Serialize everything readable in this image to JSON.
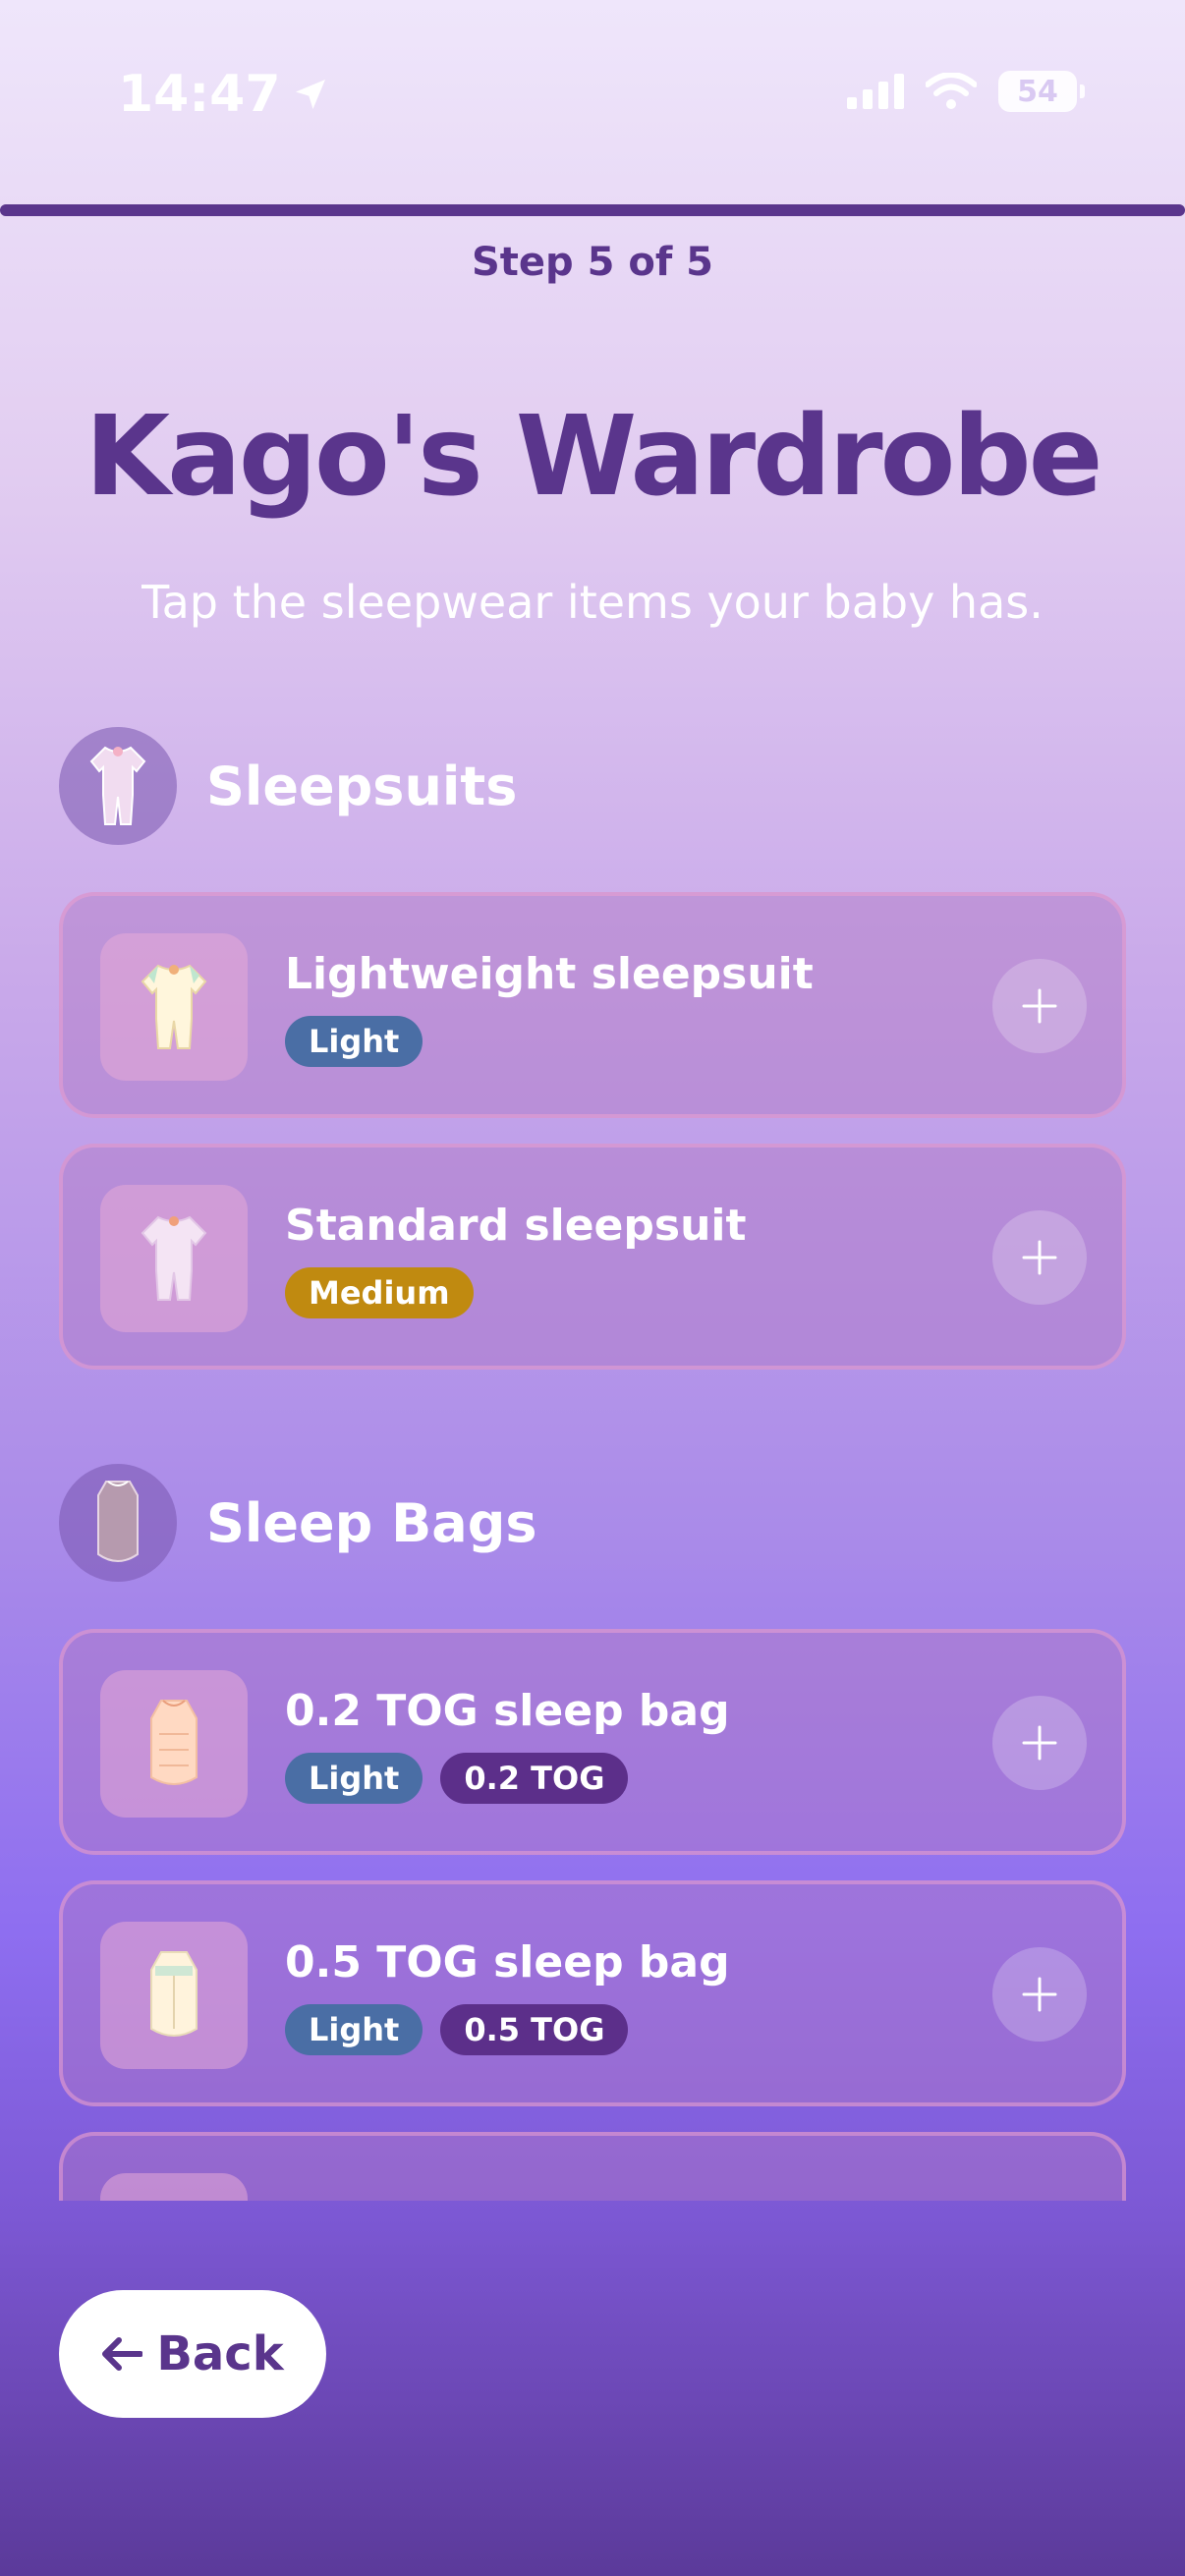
{
  "status_bar": {
    "time": "14:47",
    "battery": "54"
  },
  "progress": {
    "fraction": 1.0,
    "label": "Step 5 of 5"
  },
  "header": {
    "title": "Kago's Wardrobe",
    "subtitle": "Tap the sleepwear items your baby has."
  },
  "sections": [
    {
      "title": "Sleepsuits",
      "icon": "sleepsuit-icon",
      "items": [
        {
          "name": "Lightweight sleepsuit",
          "tags": [
            "Light"
          ]
        },
        {
          "name": "Standard sleepsuit",
          "tags": [
            "Medium"
          ]
        }
      ]
    },
    {
      "title": "Sleep Bags",
      "icon": "sleep-bag-icon",
      "items": [
        {
          "name": "0.2 TOG sleep bag",
          "tags": [
            "Light",
            "0.2 TOG"
          ]
        },
        {
          "name": "0.5 TOG sleep bag",
          "tags": [
            "Light",
            "0.5 TOG"
          ]
        }
      ]
    }
  ],
  "footer": {
    "back_label": "Back"
  },
  "colors": {
    "primary": "#5a358c",
    "tag_light": "#4a6ea5",
    "tag_medium": "#c08a10",
    "tag_tog": "#5c2f8a"
  }
}
